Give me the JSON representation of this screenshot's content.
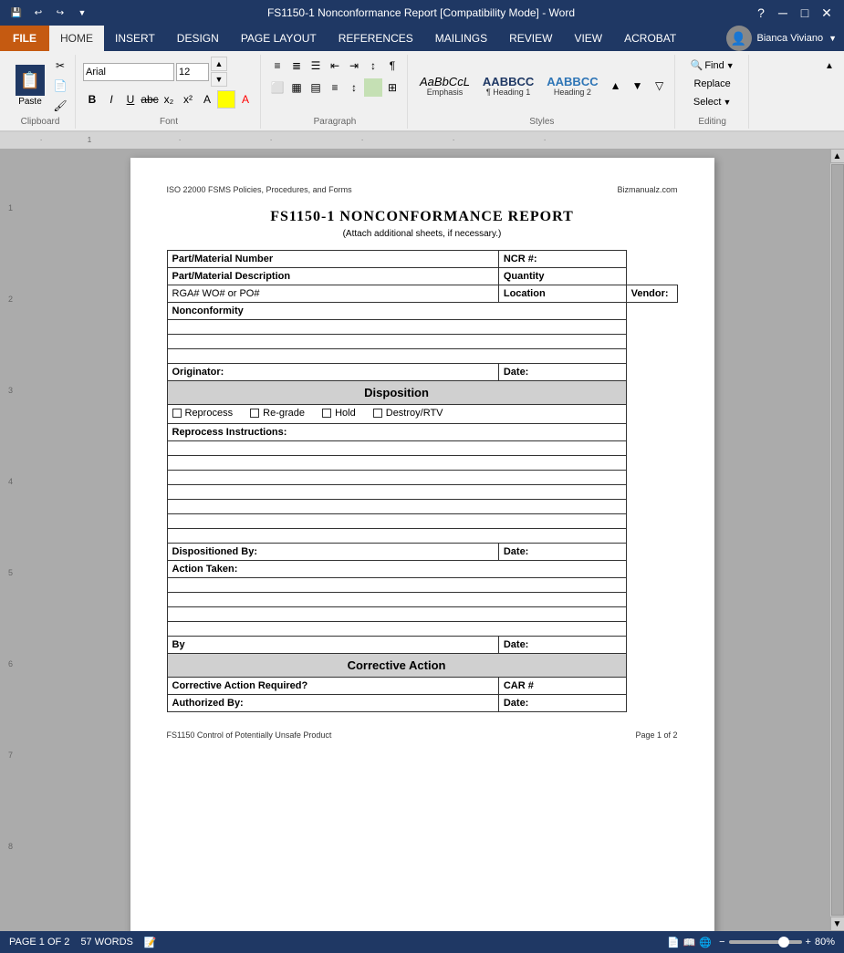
{
  "titlebar": {
    "title": "FS1150-1 Nonconformance Report [Compatibility Mode] - Word",
    "left_icon": "💾",
    "undo_icon": "↩",
    "redo_icon": "↪",
    "help_icon": "?",
    "min_icon": "─",
    "max_icon": "□",
    "close_icon": "✕",
    "ribbon_display_icon": "▲"
  },
  "tabs": {
    "file": "FILE",
    "home": "HOME",
    "insert": "INSERT",
    "design": "DESIGN",
    "page_layout": "PAGE LAYOUT",
    "references": "REFERENCES",
    "mailings": "MAILINGS",
    "review": "REVIEW",
    "view": "VIEW",
    "acrobat": "ACROBAT",
    "user": "Bianca Viviano"
  },
  "ribbon": {
    "clipboard_label": "Clipboard",
    "paste_label": "Paste",
    "font_label": "Font",
    "font_name": "Arial",
    "font_size": "12",
    "bold": "B",
    "italic": "I",
    "underline": "U",
    "paragraph_label": "Paragraph",
    "styles_label": "Styles",
    "editing_label": "Editing",
    "find_label": "Find",
    "replace_label": "Replace",
    "select_label": "Select",
    "style1_preview": "AaBbCcL",
    "style1_label": "Emphasis",
    "style2_preview": "AABBCC",
    "style2_label": "¶ Heading 1",
    "style3_preview": "AABBCC",
    "style3_label": "Heading 2"
  },
  "document": {
    "header_left": "ISO 22000 FSMS Policies, Procedures, and Forms",
    "header_right": "Bizmanualz.com",
    "title": "FS1150-1   NONCONFORMANCE REPORT",
    "subtitle": "(Attach additional sheets, if necessary.)",
    "form": {
      "part_material_number_label": "Part/Material Number",
      "ncr_label": "NCR #:",
      "part_material_desc_label": "Part/Material Description",
      "quantity_label": "Quantity",
      "rga_label": "RGA# WO# or PO#",
      "location_label": "Location",
      "vendor_label": "Vendor:",
      "nonconformity_label": "Nonconformity",
      "originator_label": "Originator:",
      "date_label": "Date:",
      "disposition_header": "Disposition",
      "reprocess_label": "Reprocess",
      "regrade_label": "Re-grade",
      "hold_label": "Hold",
      "destroy_label": "Destroy/RTV",
      "reprocess_instr_label": "Reprocess Instructions:",
      "dispositioned_by_label": "Dispositioned By:",
      "date2_label": "Date:",
      "action_taken_label": "Action Taken:",
      "by_label": "By",
      "date3_label": "Date:",
      "corrective_action_header": "Corrective Action",
      "corrective_action_req_label": "Corrective Action Required?",
      "car_label": "CAR #",
      "authorized_by_label": "Authorized By:",
      "date4_label": "Date:"
    },
    "footer_left": "FS1150 Control of Potentially Unsafe Product",
    "footer_right": "Page 1 of 2"
  },
  "statusbar": {
    "page_info": "PAGE 1 OF 2",
    "word_count": "57 WORDS",
    "zoom_label": "80%",
    "zoom_minus": "−",
    "zoom_plus": "+"
  }
}
